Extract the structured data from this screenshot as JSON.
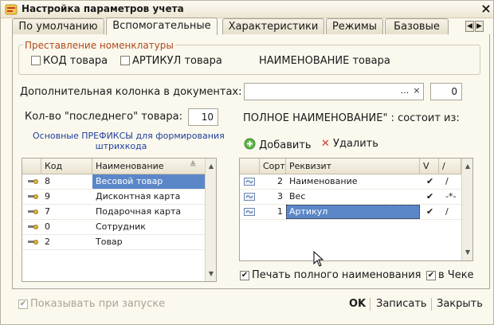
{
  "window": {
    "title": "Настройка параметров учета",
    "close": "×"
  },
  "tabs": [
    {
      "label": "По умолчанию",
      "active": false
    },
    {
      "label": "Вспомогательные",
      "active": true
    },
    {
      "label": "Характеристики",
      "active": false
    },
    {
      "label": "Режимы",
      "active": false
    },
    {
      "label": "Базовые",
      "active": false
    }
  ],
  "tab_scroll": {
    "left": "◀",
    "right": "▶"
  },
  "nomenclature": {
    "group_label": "Преставление номенклатуры",
    "code_label": "КОД товара",
    "code_checked": false,
    "article_label": "АРТИКУЛ товара",
    "article_checked": false,
    "name_label": "НАИМЕНОВАНИЕ товара"
  },
  "extra_column": {
    "label": "Дополнительная колонка в документах:",
    "value": "",
    "select_btn": "...",
    "clear_btn": "×",
    "number": "0"
  },
  "last_goods": {
    "label": "Кол-во \"последнего\" товара:",
    "value": "10"
  },
  "full_name": {
    "label": "ПОЛНОЕ НАИМЕНОВАНИЕ\" : состоит из:"
  },
  "prefix_link": {
    "line1": "Основные ПРЕФИКСЫ для формирования",
    "line2": "штрихкода"
  },
  "actions": {
    "add": "Добавить",
    "delete": "Удалить"
  },
  "prefix_table": {
    "columns": [
      "Код",
      "Наименование"
    ],
    "rows": [
      {
        "code": "8",
        "name": "Весовой товар",
        "selected": true
      },
      {
        "code": "9",
        "name": "Дисконтная карта",
        "selected": false
      },
      {
        "code": "7",
        "name": "Подарочная карта",
        "selected": false
      },
      {
        "code": "0",
        "name": "Сотрудник",
        "selected": false
      },
      {
        "code": "2",
        "name": "Товар",
        "selected": false
      }
    ]
  },
  "attr_table": {
    "columns": [
      "Сорт",
      "Реквизит",
      "V",
      "/"
    ],
    "rows": [
      {
        "sort": "2",
        "attr": "Наименование",
        "v": "✔",
        "sep": "/",
        "selected": false
      },
      {
        "sort": "3",
        "attr": "Вес",
        "v": "✔",
        "sep": "-*-",
        "selected": false
      },
      {
        "sort": "1",
        "attr": "Артикул",
        "v": "✔",
        "sep": "/",
        "selected": true
      }
    ]
  },
  "print_full_name": {
    "label": "Печать полного наименования",
    "checked": true
  },
  "in_receipt": {
    "label": "в Чеке",
    "checked": true
  },
  "show_on_start": {
    "label": "Показывать при запуске",
    "checked": true
  },
  "footer": {
    "ok": "OK",
    "save": "Записать",
    "close": "Закрыть"
  },
  "colors": {
    "accent_orange": "#b0491a",
    "link_blue": "#1f3f9b",
    "selection": "#5b87c9"
  }
}
